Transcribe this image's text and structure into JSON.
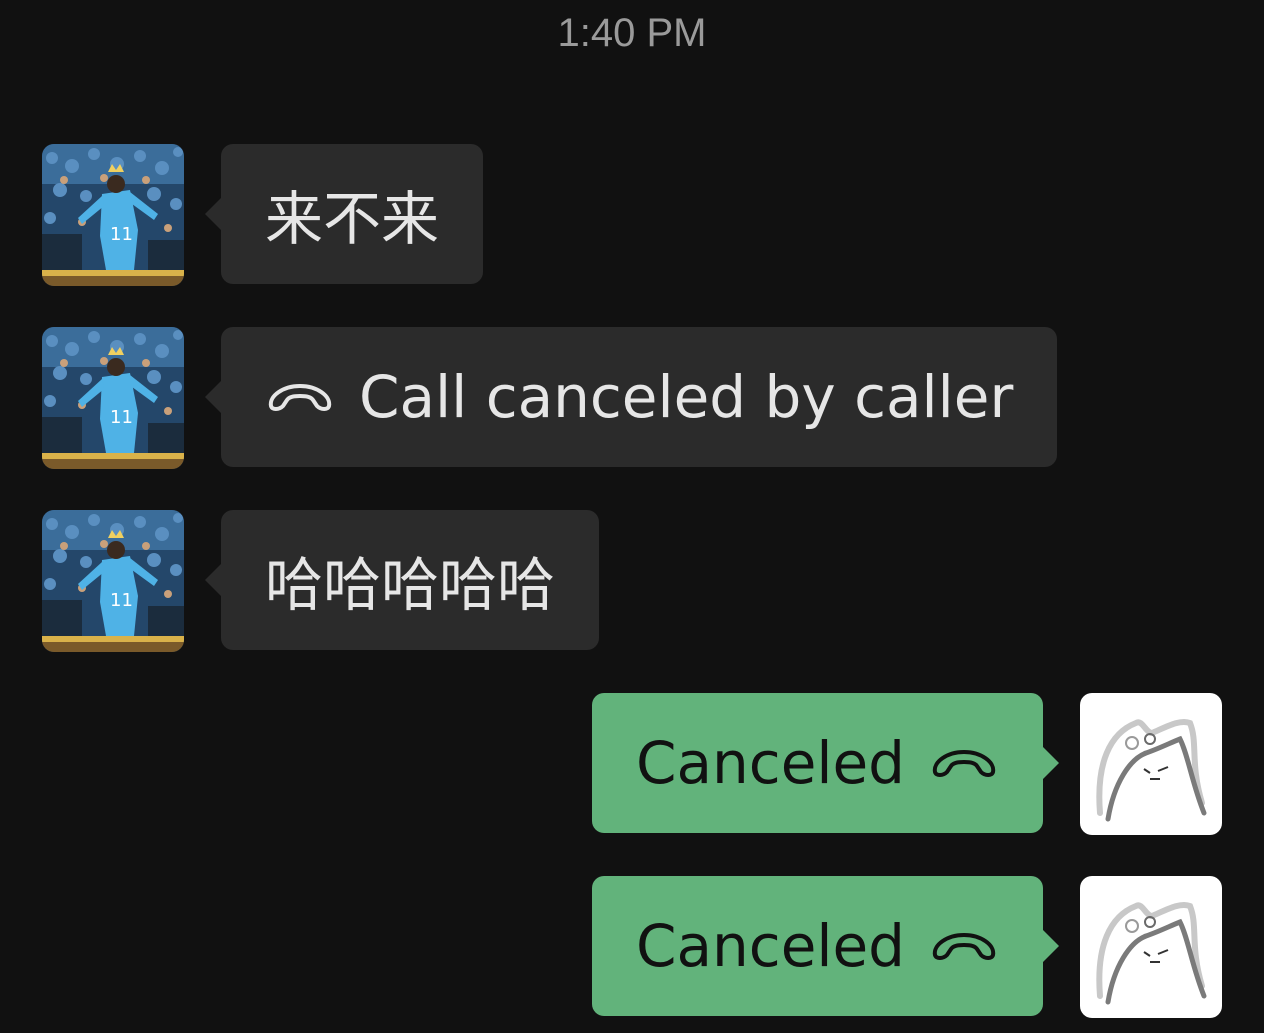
{
  "header": {
    "timestamp": "1:40 PM"
  },
  "messages": [
    {
      "direction": "incoming",
      "type": "text",
      "text": "来不来"
    },
    {
      "direction": "incoming",
      "type": "call",
      "text": "Call canceled by caller",
      "icon": "hang-up-phone-icon"
    },
    {
      "direction": "incoming",
      "type": "text",
      "text": "哈哈哈哈哈"
    },
    {
      "direction": "outgoing",
      "type": "call",
      "text": "Canceled",
      "icon": "hang-up-phone-icon"
    },
    {
      "direction": "outgoing",
      "type": "call",
      "text": "Canceled",
      "icon": "hang-up-phone-icon"
    }
  ],
  "contact": {
    "avatar_icon": "soccer-player-avatar-icon"
  },
  "self": {
    "avatar_icon": "cat-sketch-avatar-icon"
  },
  "colors": {
    "background": "#111111",
    "incoming_bubble": "#2b2b2b",
    "outgoing_bubble": "#62b37b",
    "timestamp": "#9a9a9a"
  }
}
